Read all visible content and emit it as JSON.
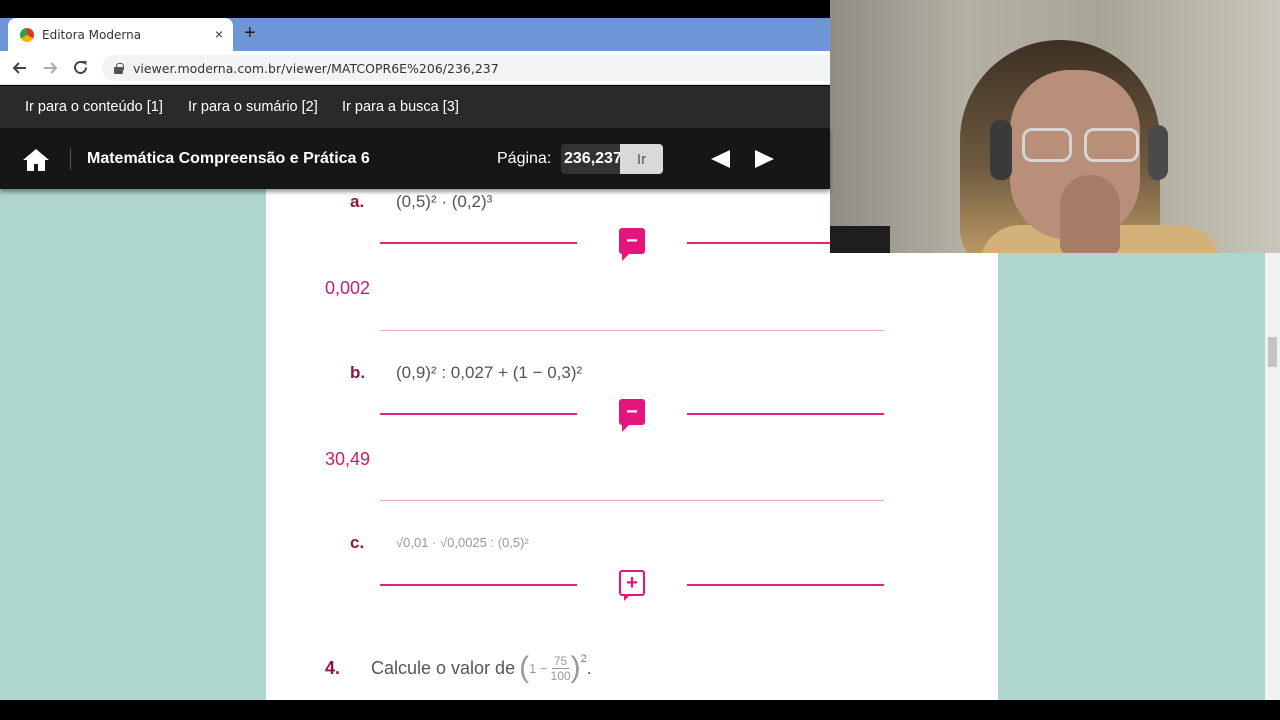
{
  "browser": {
    "tab_title": "Editora Moderna",
    "tab_close": "×",
    "new_tab": "+",
    "url": "viewer.moderna.com.br/viewer/MATCOPR6E%206/236,237"
  },
  "skip_links": [
    "Ir para o conteúdo [1]",
    "Ir para o sumário [2]",
    "Ir para a busca [3]"
  ],
  "viewer": {
    "book_title": "Matemática Compreensão e Prática 6",
    "page_label": "Página:",
    "page_value": "236,237",
    "go_label": "Ir"
  },
  "content": {
    "items": [
      {
        "letter": "a.",
        "expression": "(0,5)² · (0,2)³",
        "answer": "0,002",
        "toggle": "−"
      },
      {
        "letter": "b.",
        "expression": "(0,9)² : 0,027 + (1 − 0,3)²",
        "answer": "30,49",
        "toggle": "−"
      },
      {
        "letter": "c.",
        "expression": "√0,01 · √0,0025 : (0,5)²",
        "toggle": "+"
      }
    ],
    "question4": {
      "number": "4.",
      "text": "Calcule o valor de",
      "frac_num": "75",
      "frac_den": "100",
      "one_minus": "1 −",
      "exponent": "2"
    }
  },
  "colors": {
    "accent": "#e6157b",
    "letter": "#8c1740",
    "background": "#afd5cf"
  }
}
